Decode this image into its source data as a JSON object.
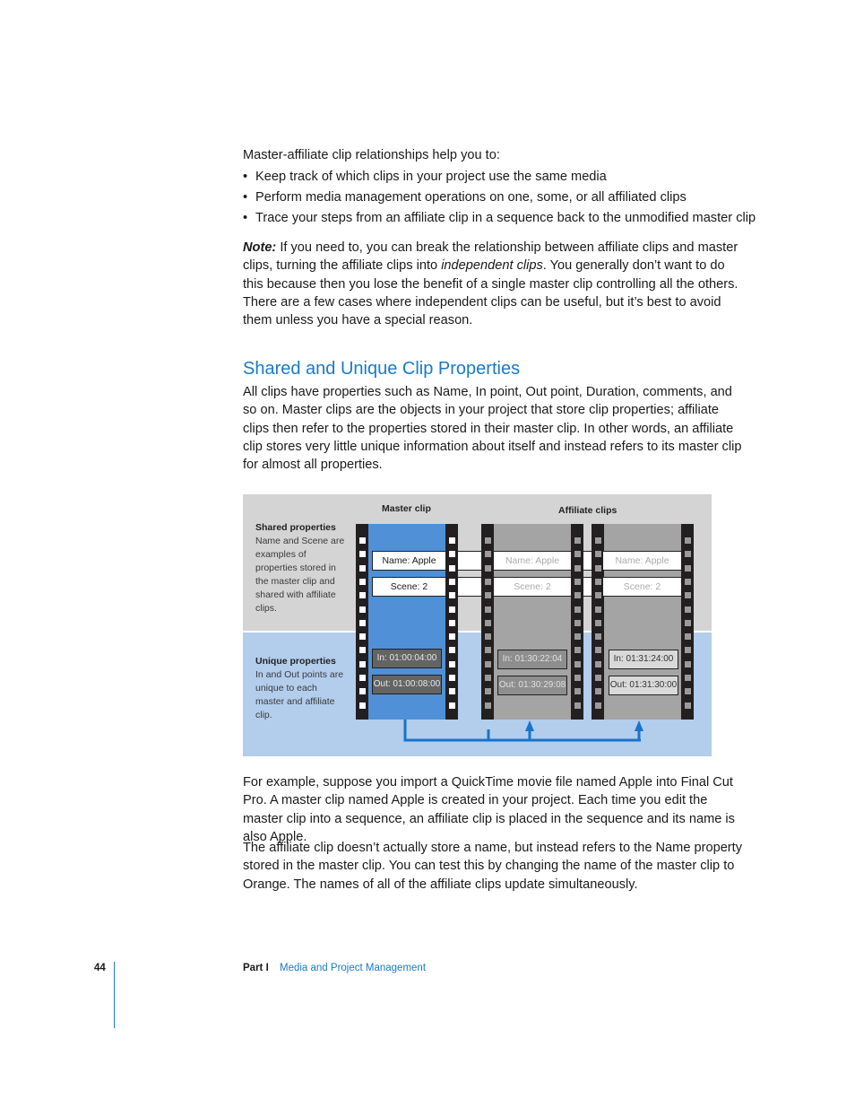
{
  "intro": "Master-affiliate clip relationships help you to:",
  "bullets": [
    "Keep track of which clips in your project use the same media",
    "Perform media management operations on one, some, or all affiliated clips",
    "Trace your steps from an affiliate clip in a sequence back to the unmodified master clip"
  ],
  "bullet_glyph": "•",
  "note": {
    "label": "Note:",
    "text_before": " If you need to, you can break the relationship between affiliate clips and master clips, turning the affiliate clips into ",
    "emphasis": "independent clips",
    "text_after": ". You generally don’t want to do this because then you lose the benefit of a single master clip controlling all the others. There are a few cases where independent clips can be useful, but it’s best to avoid them unless you have a special reason."
  },
  "section": {
    "heading": "Shared and Unique Clip Properties",
    "paragraph": "All clips have properties such as Name, In point, Out point, Duration, comments, and so on. Master clips are the objects in your project that store clip properties; affiliate clips then refer to the properties stored in their master clip. In other words, an affiliate clip stores very little unique information about itself and instead refers to its master clip for almost all properties."
  },
  "figure": {
    "master_header": "Master clip",
    "affiliate_header": "Affiliate clips",
    "shared_title": "Shared properties",
    "shared_desc": "Name and Scene are examples of properties stored in the master clip and shared with affiliate clips.",
    "unique_title": "Unique properties",
    "unique_desc": "In and Out points are unique to each master and affiliate clip.",
    "colors": {
      "master": "#4f90d6",
      "affiliate": "#a5a4a4",
      "arrow": "#1874c9",
      "shared_bg": "#d4d4d4",
      "unique_bg": "#b3cdec"
    },
    "clips": [
      {
        "type": "master",
        "name": "Name: Apple",
        "scene": "Scene: 2",
        "in": "In: 01:00:04:00",
        "out": "Out: 01:00:08:00"
      },
      {
        "type": "affiliate",
        "name": "Name: Apple",
        "scene": "Scene: 2",
        "in": "In: 01:30:22:04",
        "out": "Out: 01:30:29:08"
      },
      {
        "type": "affiliate",
        "name": "Name: Apple",
        "scene": "Scene: 2",
        "in": "In: 01:31:24:00",
        "out": "Out: 01:31:30:00"
      }
    ]
  },
  "para_example": "For example, suppose you import a QuickTime movie file named Apple into Final Cut Pro. A master clip named Apple is created in your project. Each time you edit the master clip into a sequence, an affiliate clip is placed in the sequence and its name is also Apple.",
  "para_name": "The affiliate clip doesn’t actually store a name, but instead refers to the Name property stored in the master clip. You can test this by changing the name of the master clip to Orange. The names of all of the affiliate clips update simultaneously.",
  "footer": {
    "page_number": "44",
    "part": "Part I",
    "title": "Media and Project Management"
  }
}
